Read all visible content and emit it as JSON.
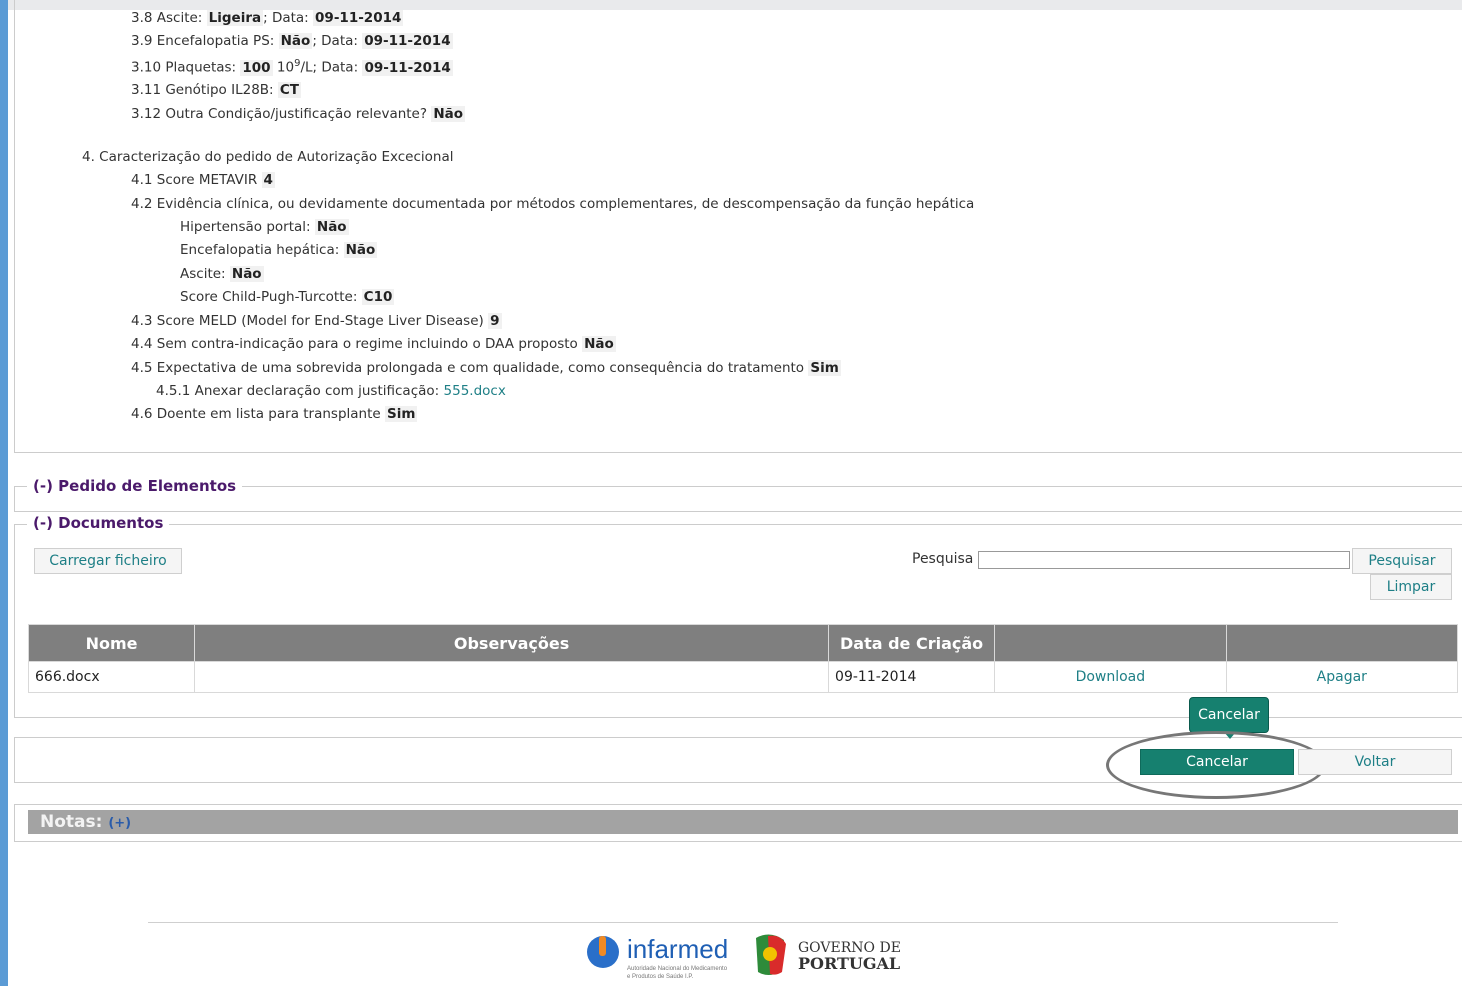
{
  "details": {
    "l38": {
      "label": "3.8 Ascite:",
      "v1": "Ligeira",
      "mid": "; Data:",
      "v2": "09-11-2014"
    },
    "l39": {
      "label": "3.9 Encefalopatia PS:",
      "v1": "Não",
      "mid": "; Data:",
      "v2": "09-11-2014"
    },
    "l310": {
      "label": "3.10 Plaquetas:",
      "v1": "100",
      "unit_pre": "10",
      "unit_sup": "9",
      "unit_post": "/L; Data:",
      "v2": "09-11-2014"
    },
    "l311": {
      "label": "3.11 Genótipo IL28B:",
      "v1": "CT"
    },
    "l312": {
      "label": "3.12 Outra Condição/justificação relevante?",
      "v1": "Não"
    },
    "s4": "4. Caracterização do pedido de Autorização Excecional",
    "l41": {
      "label": "4.1 Score METAVIR",
      "v1": "4"
    },
    "l42": "4.2 Evidência clínica, ou devidamente documentada por métodos complementares, de descompensação da função hepática",
    "hp": {
      "label": "Hipertensão portal:",
      "v1": "Não"
    },
    "eh": {
      "label": "Encefalopatia hepática:",
      "v1": "Não"
    },
    "asc": {
      "label": "Ascite:",
      "v1": "Não"
    },
    "cpt": {
      "label": "Score Child-Pugh-Turcotte:",
      "v1": "C10"
    },
    "l43": {
      "label": "4.3 Score MELD (Model for End-Stage Liver Disease)",
      "v1": "9"
    },
    "l44": {
      "label": "4.4 Sem contra-indicação para o regime incluindo o DAA proposto",
      "v1": "Não"
    },
    "l45": {
      "label": "4.5 Expectativa de uma sobrevida prolongada e com qualidade, como consequência do tratamento",
      "v1": "Sim"
    },
    "l451": {
      "label": "4.5.1 Anexar declaração com justificação:",
      "link": "555.docx"
    },
    "l46": {
      "label": "4.6 Doente em lista para transplante",
      "v1": "Sim"
    }
  },
  "sections": {
    "pedido": "(-) Pedido de Elementos",
    "documentos": "(-) Documentos"
  },
  "documents": {
    "upload": "Carregar ficheiro",
    "search_label": "Pesquisa",
    "search_value": "",
    "search_btn": "Pesquisar",
    "clear_btn": "Limpar",
    "columns": [
      "Nome",
      "Observações",
      "Data de Criação",
      "",
      ""
    ],
    "rows": [
      {
        "name": "666.docx",
        "obs": "",
        "date": "09-11-2014",
        "download": "Download",
        "delete": "Apagar"
      }
    ]
  },
  "actions": {
    "tooltip": "Cancelar",
    "cancel": "Cancelar",
    "back": "Voltar"
  },
  "notes": {
    "label": "Notas:",
    "toggle": "(+)"
  },
  "footer": {
    "infarmed_brand": "infarmed",
    "infarmed_sub1": "Autoridade Nacional do Medicamento",
    "infarmed_sub2": "e Produtos de Saúde I.P.",
    "gov1": "GOVERNO DE",
    "gov2": "PORTUGAL"
  },
  "colors": {
    "accent": "#16806f",
    "link": "#1e7f86",
    "legend": "#4b1a6b",
    "header": "#7f7f7f"
  }
}
